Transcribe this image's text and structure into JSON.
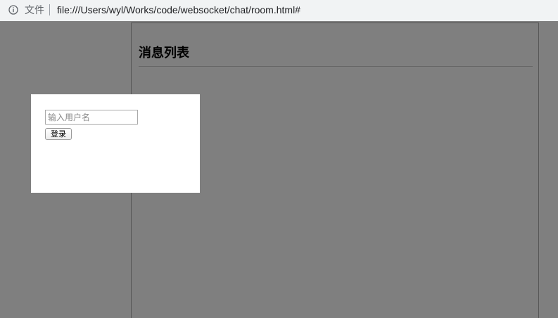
{
  "browser": {
    "scheme_label": "文件",
    "url": "file:///Users/wyl/Works/code/websocket/chat/room.html#"
  },
  "page": {
    "message_list_title": "消息列表"
  },
  "login_modal": {
    "username_placeholder": "输入用户名",
    "username_value": "",
    "login_label": "登录"
  }
}
